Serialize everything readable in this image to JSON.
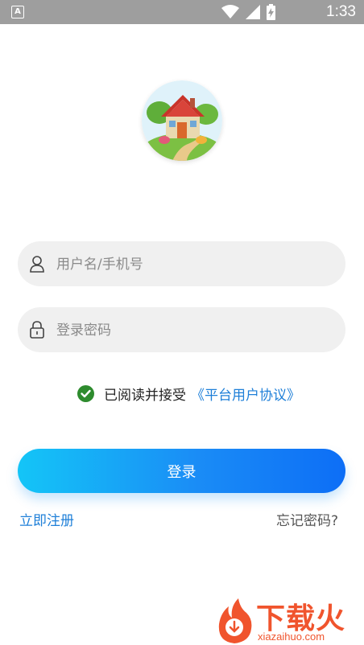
{
  "status_bar": {
    "time": "1:33",
    "app_icon_letter": "A",
    "icons": [
      "wifi-icon",
      "signal-icon",
      "battery-charging-icon"
    ]
  },
  "logo": {
    "icon": "house-logo-icon"
  },
  "form": {
    "username": {
      "placeholder": "用户名/手机号",
      "value": "",
      "icon": "user-icon"
    },
    "password": {
      "placeholder": "登录密码",
      "value": "",
      "icon": "lock-icon"
    }
  },
  "agreement": {
    "checked": true,
    "text": "已阅读并接受",
    "link": "《平台用户协议》"
  },
  "buttons": {
    "login": "登录"
  },
  "links": {
    "register": "立即注册",
    "forgot": "忘记密码?"
  },
  "watermark": {
    "text": "下载火",
    "url": "xiazaihuo.com"
  },
  "colors": {
    "accent": "#1e7fd8",
    "button_gradient_start": "#14c5f7",
    "button_gradient_end": "#0d6ef6",
    "check": "#2e8b2e",
    "watermark": "#f0542d"
  }
}
